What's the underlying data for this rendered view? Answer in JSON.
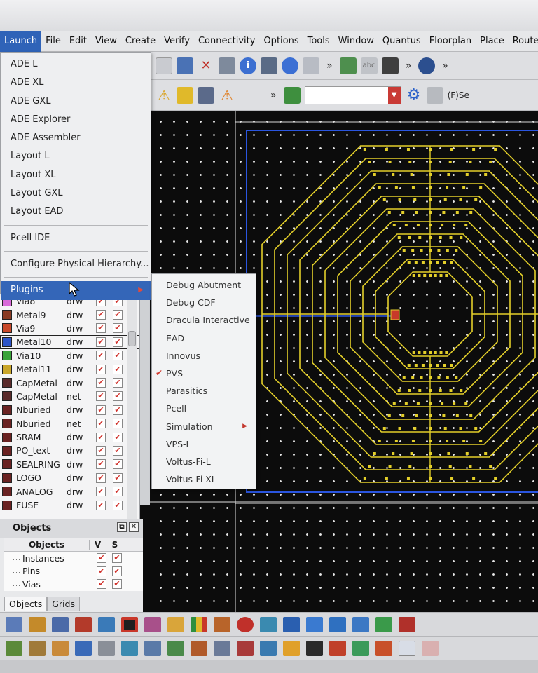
{
  "menubar": {
    "items": [
      "Launch",
      "File",
      "Edit",
      "View",
      "Create",
      "Verify",
      "Connectivity",
      "Options",
      "Tools",
      "Window",
      "Quantus",
      "Floorplan",
      "Place",
      "Route"
    ]
  },
  "toolbar2": {
    "label": "(F)Se"
  },
  "launch_menu": {
    "items": [
      "ADE L",
      "ADE XL",
      "ADE GXL",
      "ADE Explorer",
      "ADE Assembler",
      "Layout L",
      "Layout XL",
      "Layout GXL",
      "Layout EAD"
    ],
    "pcell_ide": "Pcell IDE",
    "configure": "Configure Physical Hierarchy...",
    "plugins": "Plugins"
  },
  "plugins_menu": {
    "items": [
      "Debug Abutment",
      "Debug CDF",
      "Dracula Interactive",
      "EAD",
      "Innovus",
      "PVS",
      "Parasitics",
      "Pcell",
      "Simulation",
      "VPS-L",
      "Voltus-Fi-L",
      "Voltus-Fi-XL"
    ],
    "checked": "PVS",
    "submenu": "Simulation"
  },
  "layers": [
    {
      "name": "Via8",
      "purpose": "drw",
      "color": "#d96bd9"
    },
    {
      "name": "Metal9",
      "purpose": "drw",
      "color": "#8a3a22"
    },
    {
      "name": "Via9",
      "purpose": "drw",
      "color": "#c8482a"
    },
    {
      "name": "Metal10",
      "purpose": "drw",
      "color": "#2c54c8"
    },
    {
      "name": "Via10",
      "purpose": "drw",
      "color": "#3aa33a"
    },
    {
      "name": "Metal11",
      "purpose": "drw",
      "color": "#c9a62a"
    },
    {
      "name": "CapMetal",
      "purpose": "drw",
      "color": "#5a2a2a"
    },
    {
      "name": "CapMetal",
      "purpose": "net",
      "color": "#5a2a2a"
    },
    {
      "name": "Nburied",
      "purpose": "drw",
      "color": "#6a2222"
    },
    {
      "name": "Nburied",
      "purpose": "net",
      "color": "#6a2222"
    },
    {
      "name": "SRAM",
      "purpose": "drw",
      "color": "#6a2222"
    },
    {
      "name": "PO_text",
      "purpose": "drw",
      "color": "#6a2222"
    },
    {
      "name": "SEALRING",
      "purpose": "drw",
      "color": "#6a2222"
    },
    {
      "name": "LOGO",
      "purpose": "drw",
      "color": "#6a2222"
    },
    {
      "name": "ANALOG",
      "purpose": "drw",
      "color": "#6a2222"
    },
    {
      "name": "FUSE",
      "purpose": "drw",
      "color": "#6a2222"
    }
  ],
  "objects_panel": {
    "title": "Objects",
    "col_objects": "Objects",
    "col_v": "V",
    "col_s": "S",
    "rows": [
      "Instances",
      "Pins",
      "Vias"
    ],
    "tab_objects": "Objects",
    "tab_grids": "Grids"
  },
  "colors": {
    "menu_highlight": "#3466b8",
    "layout_metal": "#e3cf2a",
    "canvas_bg": "#0c0c0c",
    "prboundary": "#2a55e0"
  }
}
